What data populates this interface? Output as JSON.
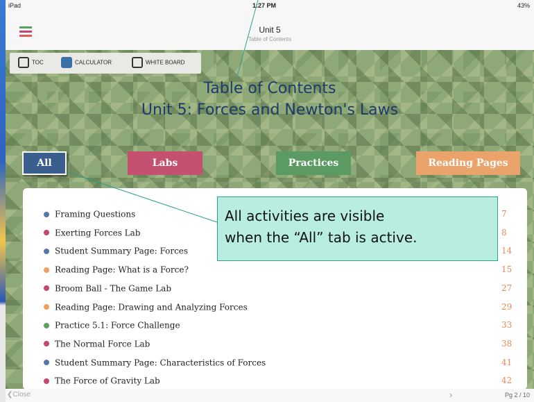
{
  "status": {
    "left": "iPad",
    "time": "1:27 PM",
    "right": "43%"
  },
  "nav": {
    "title": "Unit 5",
    "subtitle": "Table of Contents"
  },
  "toolbar": {
    "toc": "TOC",
    "calculator": "CALCULATOR",
    "whiteboard": "WHITE BOARD"
  },
  "header": {
    "line1": "Table of Contents",
    "line2": "Unit 5: Forces and Newton's Laws"
  },
  "tabs": {
    "all": "All",
    "labs": "Labs",
    "practices": "Practices",
    "reading": "Reading Pages"
  },
  "colors": {
    "reading": "#5577aa",
    "lab": "#c7446a",
    "readingpage": "#f0a060",
    "practice": "#5aa05f",
    "pagenum": "#e68a5a"
  },
  "items": [
    {
      "name": "Framing Questions",
      "page": "7",
      "kind": "summary"
    },
    {
      "name": "Exerting Forces Lab",
      "page": "8",
      "kind": "lab"
    },
    {
      "name": "Student Summary Page: Forces",
      "page": "14",
      "kind": "summary"
    },
    {
      "name": "Reading Page: What is a Force?",
      "page": "15",
      "kind": "reading"
    },
    {
      "name": "Broom Ball - The Game Lab",
      "page": "27",
      "kind": "lab"
    },
    {
      "name": "Reading Page: Drawing and Analyzing Forces",
      "page": "29",
      "kind": "reading"
    },
    {
      "name": "Practice 5.1: Force Challenge",
      "page": "33",
      "kind": "practice"
    },
    {
      "name": "The Normal Force Lab",
      "page": "38",
      "kind": "lab"
    },
    {
      "name": "Student Summary Page: Characteristics of Forces",
      "page": "41",
      "kind": "summary"
    },
    {
      "name": "The Force of Gravity Lab",
      "page": "42",
      "kind": "lab"
    }
  ],
  "callout": {
    "line1": "All activities are visible",
    "line2": "when the “All” tab is active."
  },
  "bottom": {
    "close": "Close",
    "page": "Pg 2 / 10"
  }
}
